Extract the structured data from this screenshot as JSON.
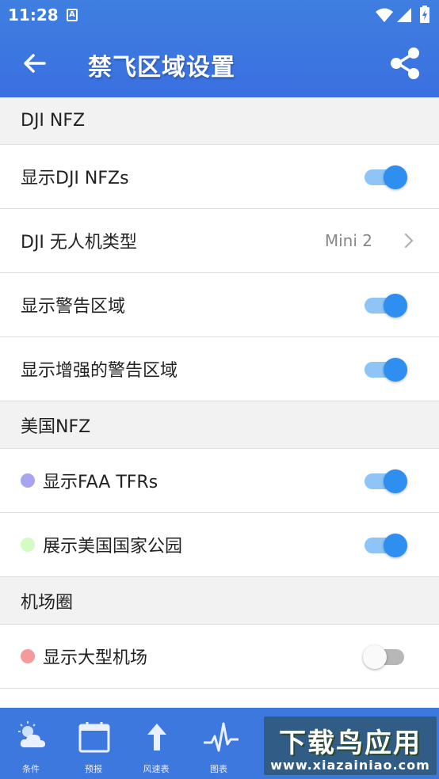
{
  "status_bar": {
    "time": "11:28",
    "notification_badge": "A"
  },
  "app_bar": {
    "title": "禁飞区域设置",
    "back_icon": "arrow-left-icon",
    "share_icon": "share-icon"
  },
  "sections": [
    {
      "header": "DJI NFZ",
      "rows": [
        {
          "label": "显示DJI NFZs",
          "type": "toggle",
          "on": true
        },
        {
          "label": "DJI 无人机类型",
          "type": "select",
          "value": "Mini 2"
        },
        {
          "label": "显示警告区域",
          "type": "toggle",
          "on": true
        },
        {
          "label": "显示增强的警告区域",
          "type": "toggle",
          "on": true
        }
      ]
    },
    {
      "header": "美国NFZ",
      "rows": [
        {
          "label": "显示FAA TFRs",
          "type": "toggle",
          "on": true,
          "dot_color": "#a9a4f2"
        },
        {
          "label": "展示美国国家公园",
          "type": "toggle",
          "on": true,
          "dot_color": "#d4fbc4"
        }
      ]
    },
    {
      "header": "机场圈",
      "rows": [
        {
          "label": "显示大型机场",
          "type": "toggle",
          "on": false,
          "dot_color": "#f49a9a"
        }
      ]
    }
  ],
  "bottom_nav": [
    {
      "label": "条件",
      "icon": "weather-cloud-sun-icon"
    },
    {
      "label": "预报",
      "icon": "calendar-icon"
    },
    {
      "label": "风速表",
      "icon": "arrow-up-icon"
    },
    {
      "label": "图表",
      "icon": "pulse-chart-icon"
    }
  ],
  "watermark": {
    "title": "下载鸟应用",
    "url": "www.xiazainiao.com"
  },
  "colors": {
    "app_bar": "#3a6fe0",
    "switch_on": "#2e8ff0",
    "switch_track_on": "#8fc4f7",
    "switch_off_track": "#b7b7b7"
  }
}
